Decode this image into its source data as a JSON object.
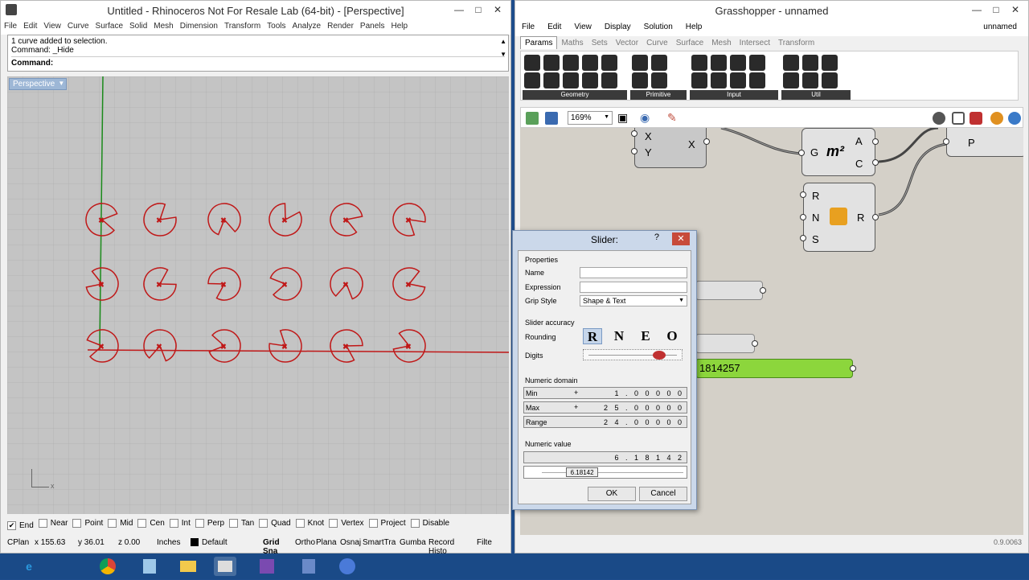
{
  "rhino": {
    "title": "Untitled - Rhinoceros Not For Resale Lab (64-bit) - [Perspective]",
    "menu": [
      "File",
      "Edit",
      "View",
      "Curve",
      "Surface",
      "Solid",
      "Mesh",
      "Dimension",
      "Transform",
      "Tools",
      "Analyze",
      "Render",
      "Panels",
      "Help"
    ],
    "command_history": [
      "1 curve added to selection.",
      "Command: _Hide"
    ],
    "command_prompt": "Command:",
    "viewport_label": "Perspective",
    "axis_x": "x",
    "osnaps": [
      {
        "label": "End",
        "checked": true
      },
      {
        "label": "Near",
        "checked": false
      },
      {
        "label": "Point",
        "checked": false
      },
      {
        "label": "Mid",
        "checked": false
      },
      {
        "label": "Cen",
        "checked": false
      },
      {
        "label": "Int",
        "checked": false
      },
      {
        "label": "Perp",
        "checked": false
      },
      {
        "label": "Tan",
        "checked": false
      },
      {
        "label": "Quad",
        "checked": false
      },
      {
        "label": "Knot",
        "checked": false
      },
      {
        "label": "Vertex",
        "checked": false
      },
      {
        "label": "Project",
        "checked": false
      },
      {
        "label": "Disable",
        "checked": false
      }
    ],
    "status": {
      "cplane": "CPlan",
      "x": "x 155.63",
      "y": "y 36.01",
      "z": "z 0.00",
      "units": "Inches",
      "layer": "Default",
      "items": [
        "Grid Sna",
        "Ortho",
        "Plana",
        "Osnaj",
        "SmartTra",
        "Gumba",
        "Record Histo",
        "Filte"
      ]
    }
  },
  "grasshopper": {
    "title": "Grasshopper - unnamed",
    "doc_name": "unnamed",
    "menu": [
      "File",
      "Edit",
      "View",
      "Display",
      "Solution",
      "Help"
    ],
    "tabs": [
      "Params",
      "Maths",
      "Sets",
      "Vector",
      "Curve",
      "Surface",
      "Mesh",
      "Intersect",
      "Transform"
    ],
    "active_tab": "Params",
    "ribbon_groups": [
      "Geometry",
      "Primitive",
      "Input",
      "Util"
    ],
    "zoom": "169%",
    "version": "0.9.0063",
    "slider_value_display": "1814257",
    "nodes": {
      "xy_node": {
        "in1": "X",
        "in2": "Y",
        "out": "X"
      },
      "area_node": {
        "in": "G",
        "center": "m²",
        "out1": "A",
        "out2": "C"
      },
      "random_node": {
        "in1": "R",
        "in2": "N",
        "in3": "S",
        "out": "R"
      },
      "p_node": {
        "label": "P"
      }
    }
  },
  "dialog": {
    "title": "Slider:",
    "help": "?",
    "properties_label": "Properties",
    "name_label": "Name",
    "name_value": "",
    "expression_label": "Expression",
    "expression_value": "",
    "grip_label": "Grip Style",
    "grip_value": "Shape & Text",
    "accuracy_label": "Slider accuracy",
    "rounding_label": "Rounding",
    "rounding_options": [
      "R",
      "N",
      "E",
      "O"
    ],
    "rounding_selected": "R",
    "digits_label": "Digits",
    "domain_label": "Numeric domain",
    "min_label": "Min",
    "min_value": "1 . 0 0 0 0 0",
    "max_label": "Max",
    "max_value": "2 5 . 0 0 0 0 0",
    "range_label": "Range",
    "range_value": "2 4 . 0 0 0 0 0",
    "value_label": "Numeric value",
    "value_digits": "6 . 1 8 1 4 2",
    "value_text": "6.18142",
    "value_fraction": 0.215,
    "ok": "OK",
    "cancel": "Cancel"
  },
  "taskbar": {
    "icons": [
      "ie-icon",
      "chrome-icon",
      "app-icon",
      "folder-icon",
      "rhino-icon",
      "app2-icon",
      "app3-icon",
      "grasshopper-icon"
    ]
  }
}
